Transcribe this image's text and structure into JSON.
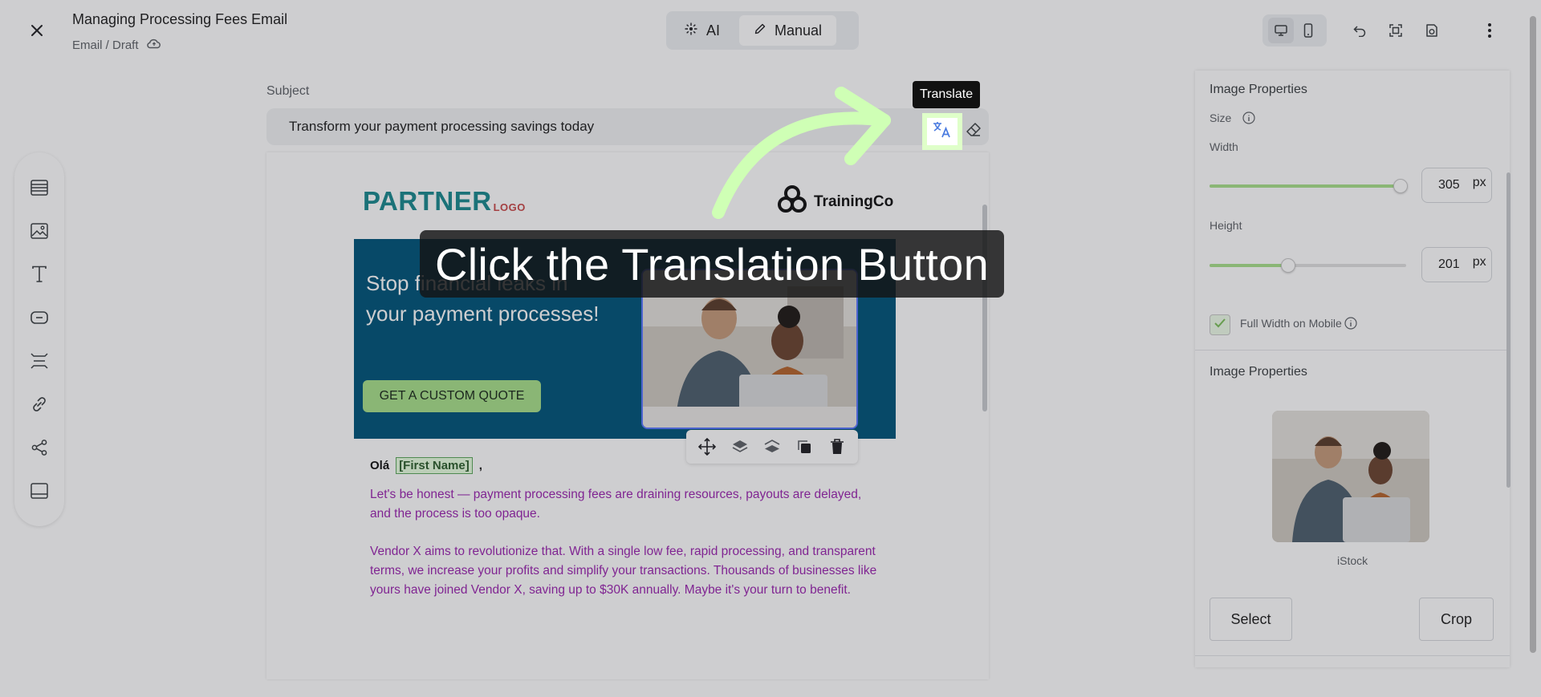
{
  "header": {
    "title": "Managing Processing Fees Email",
    "breadcrumb": "Email / Draft",
    "modes": [
      {
        "label": "AI",
        "active": false
      },
      {
        "label": "Manual",
        "active": true
      }
    ]
  },
  "subject": {
    "label": "Subject",
    "value": "Transform your payment processing savings today",
    "tooltip": "Translate"
  },
  "hint": {
    "text": "Click the Translation Button",
    "highlight_color": "#dfffc9"
  },
  "email": {
    "partner_logo": "PARTNER",
    "partner_logo_suffix": "LOGO",
    "brand_logo": "TrainingCo",
    "hero_headline": "Stop financial leaks in your payment processes!",
    "cta_label": "GET A CUSTOM QUOTE",
    "greeting": "Olá",
    "merge_tag": "[First Name]",
    "greeting_suffix": ",",
    "paragraph_1": "Let's be honest — payment processing fees are draining resources, payouts are delayed, and the process is too opaque.",
    "paragraph_2": "Vendor X aims to revolutionize that. With a single low fee, rapid processing, and transparent terms, we increase your profits and simplify your transactions. Thousands of businesses like yours have joined Vendor X, saving up to $30K annually. Maybe it's your turn to benefit."
  },
  "panel": {
    "heading": "Image Properties",
    "size_label": "Size",
    "width_label": "Width",
    "width_value": "305",
    "width_fraction": 1.0,
    "height_label": "Height",
    "height_value": "201",
    "height_fraction": 0.4,
    "unit": "px",
    "full_width_label": "Full Width on Mobile",
    "full_width_checked": true,
    "image_section_heading": "Image Properties",
    "image_source": "iStock",
    "select_label": "Select",
    "crop_label": "Crop"
  },
  "colors": {
    "accent_green": "#a8e08b",
    "hero_bg": "#00557a",
    "body_text": "#9c27b0",
    "partner_teal": "#1a8a8f"
  }
}
